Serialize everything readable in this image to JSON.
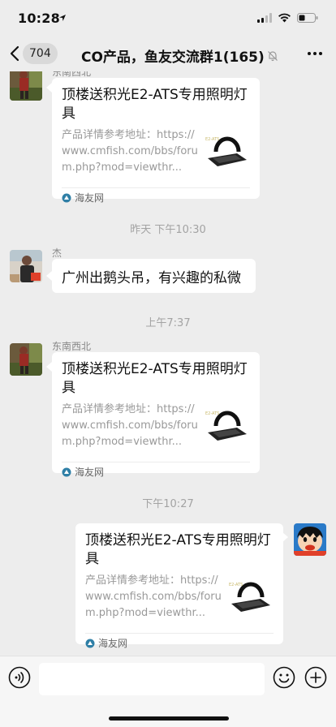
{
  "status_bar": {
    "time": "10:28"
  },
  "nav": {
    "back_count": "704",
    "title": "CO产品，鱼友交流群1(165)"
  },
  "timestamps": [
    "昨天 下午10:30",
    "上午7:37",
    "下午10:27"
  ],
  "messages": [
    {
      "sender": "东南西北",
      "card_title": "顶楼送积光E2-ATS专用照明灯具",
      "card_desc": "产品详情参考地址：https://www.cmfish.com/bbs/forum.php?mod=viewthr...",
      "source": "海友网"
    },
    {
      "sender": "杰",
      "text": "广州出鹅头吊，有兴趣的私微"
    },
    {
      "sender": "东南西北",
      "card_title": "顶楼送积光E2-ATS专用照明灯具",
      "card_desc": "产品详情参考地址：https://www.cmfish.com/bbs/forum.php?mod=viewthr...",
      "source": "海友网"
    },
    {
      "sender": "",
      "card_title": "顶楼送积光E2-ATS专用照明灯具",
      "card_desc": "产品详情参考地址：https://www.cmfish.com/bbs/forum.php?mod=viewthr...",
      "source": "海友网"
    }
  ],
  "input": {
    "placeholder": ""
  },
  "colors": {
    "background": "#ededed",
    "bubble": "#ffffff",
    "meta_text": "#a3a3a3"
  }
}
